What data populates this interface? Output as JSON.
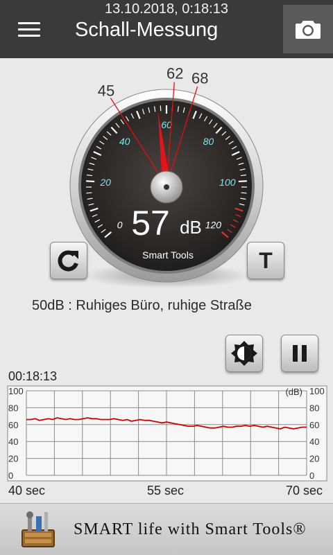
{
  "status": {
    "datetime": "13.10.2018, 0:18:13"
  },
  "header": {
    "title": "Schall-Messung",
    "menu_icon": "hamburger-menu-icon",
    "camera_icon": "camera-icon"
  },
  "gauge": {
    "value_text": "57",
    "unit": "dB",
    "brand": "Smart Tools",
    "needle_value": 57,
    "min_marker": "45",
    "avg_marker": "62",
    "max_marker": "68",
    "scale_min": 0,
    "scale_max": 120,
    "tick_labels": [
      "0",
      "20",
      "40",
      "60",
      "80",
      "100",
      "120"
    ]
  },
  "buttons": {
    "reset_icon": "refresh-icon",
    "t_label": "T",
    "brightness_icon": "brightness-icon",
    "pause_icon": "pause-icon"
  },
  "description": "50dB : Ruhiges Büro, ruhige Straße",
  "graph": {
    "elapsed": "00:18:13",
    "y_ticks": [
      "100",
      "80",
      "60",
      "40",
      "20",
      "0"
    ],
    "unit_label": "(dB)",
    "x_labels": [
      "40 sec",
      "55 sec",
      "70 sec"
    ],
    "line_color": "#cc0000",
    "values": [
      66,
      66,
      67,
      65,
      66,
      67,
      66,
      68,
      67,
      66,
      67,
      66,
      66,
      67,
      68,
      67,
      67,
      66,
      66,
      66,
      67,
      66,
      65,
      66,
      64,
      65,
      66,
      65,
      65,
      64,
      63,
      62,
      63,
      62,
      61,
      60,
      59,
      58,
      58,
      59,
      58,
      57,
      56,
      56,
      57,
      58,
      57,
      57,
      58,
      58,
      59,
      58,
      59,
      58,
      57,
      58,
      57,
      56,
      55,
      57,
      56,
      55,
      56,
      57,
      57
    ]
  },
  "footer": {
    "text": "SMART life with Smart Tools®",
    "logo_icon": "toolbox-logo-icon"
  }
}
